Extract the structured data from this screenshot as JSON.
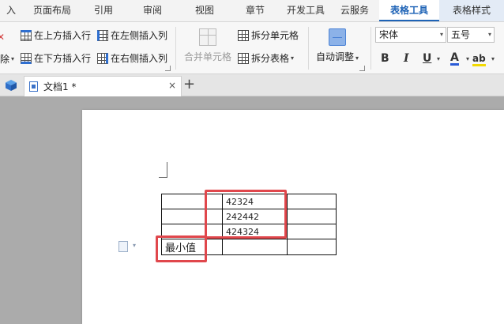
{
  "menu": {
    "tabs": [
      {
        "label": "入",
        "width": 28
      },
      {
        "label": "页面布局",
        "width": 76
      },
      {
        "label": "引用",
        "width": 54
      },
      {
        "label": "审阅",
        "width": 70
      },
      {
        "label": "视图",
        "width": 62
      },
      {
        "label": "章节",
        "width": 66
      },
      {
        "label": "开发工具",
        "width": 62
      },
      {
        "label": "云服务",
        "width": 62
      },
      {
        "label": "表格工具",
        "width": 76
      },
      {
        "label": "表格样式",
        "width": 82
      }
    ]
  },
  "ribbon": {
    "delete_label": "除",
    "insert_above": "在上方插入行",
    "insert_below": "在下方插入行",
    "insert_left": "在左侧插入列",
    "insert_right": "在右侧插入列",
    "merge_cells": "合并单元格",
    "split_cells": "拆分单元格",
    "split_table": "拆分表格",
    "auto_fit": "自动调整",
    "font_name": "宋体",
    "font_size": "五号",
    "bold": "B",
    "italic": "I",
    "underline": "U",
    "font_color": "A",
    "highlight": "ab"
  },
  "colors": {
    "accent": "#1e63b6",
    "highlight_box": "#e0474c",
    "font_color_bar": "#2a5bd7",
    "highlight_bar": "#f2d900"
  },
  "tabbar": {
    "doc_title": "文档1 *",
    "close": "×",
    "add": "+"
  },
  "document": {
    "table": [
      [
        "",
        "",
        "42324",
        ""
      ],
      [
        "",
        "",
        "242442",
        ""
      ],
      [
        "",
        "",
        "424324",
        ""
      ],
      [
        "最小值",
        "",
        "",
        ""
      ]
    ]
  }
}
